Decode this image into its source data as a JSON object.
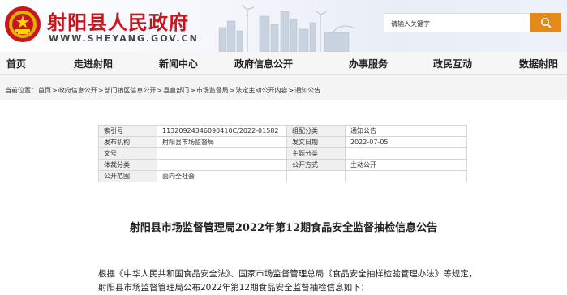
{
  "header": {
    "site_title": "射阳县人民政府",
    "site_domain": "WWW.SHEYANG.GOV.CN"
  },
  "search": {
    "placeholder": "请输入关键字"
  },
  "nav": [
    "首页",
    "走进射阳",
    "新闻中心",
    "政府信息公开",
    "办事服务",
    "政民互动",
    "数据射阳"
  ],
  "breadcrumb": [
    "当前位置：",
    "首页",
    ">",
    "政府信息公开",
    ">",
    "部门镇区信息公开",
    ">",
    "县直部门",
    ">",
    "市场监督局",
    ">",
    "法定主动公开内容",
    ">",
    "通知公告"
  ],
  "meta": {
    "index_label": "索引号",
    "index_value": "11320924346090410C/2022-01582",
    "category_label": "组配分类",
    "category_value": "通知公告",
    "issuer_label": "发布机构",
    "issuer_value": "射阳县市场监督局",
    "date_label": "发文日期",
    "date_value": "2022-07-05",
    "docno_label": "文号",
    "docno_value": "",
    "topic_label": "主题分类",
    "topic_value": "",
    "genre_label": "体裁分类",
    "genre_value": "",
    "mode_label": "公开方式",
    "mode_value": "主动公开",
    "scope_label": "公开范围",
    "scope_value": "面向全社会"
  },
  "doc_title": "射阳县市场监督管理局2022年第12期食品安全监督抽检信息公告",
  "body_text": "根据《中华人民共和国食品安全法》、国家市场监督管理总局《食品安全抽样检验管理办法》等规定，射阳县市场监督管理局公布2022年第12期食品安全监督抽检信息如下："
}
